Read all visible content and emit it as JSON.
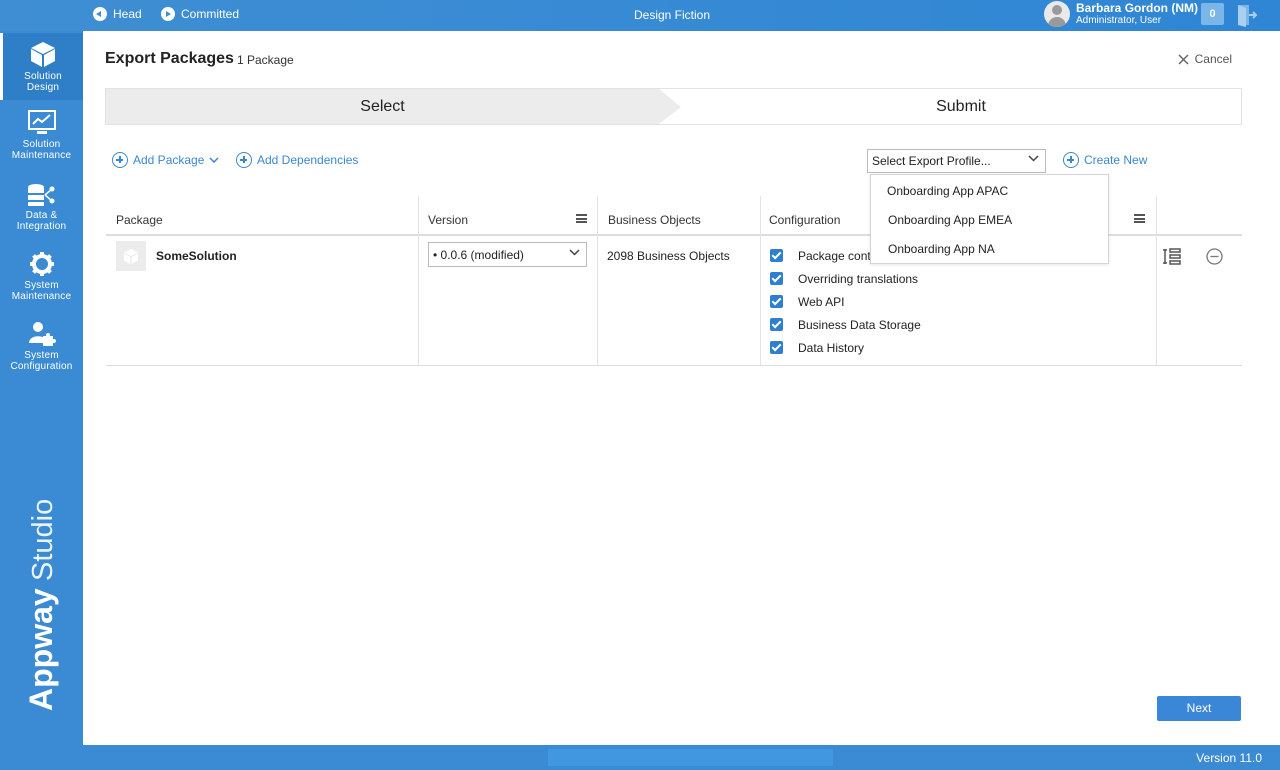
{
  "topbar": {
    "head_label": "Head",
    "committed_label": "Committed",
    "project_name": "Design Fiction",
    "user_name": "Barbara Gordon (NM)",
    "user_role": "Administrator, User",
    "notification_count": "0"
  },
  "sidebar": {
    "items": [
      {
        "label_line1": "Solution",
        "label_line2": "Design"
      },
      {
        "label_line1": "Solution",
        "label_line2": "Maintenance"
      },
      {
        "label_line1": "Data &",
        "label_line2": "Integration"
      },
      {
        "label_line1": "System",
        "label_line2": "Maintenance"
      },
      {
        "label_line1": "System",
        "label_line2": "Configuration"
      }
    ],
    "brand_bold": "Appway",
    "brand_light": "Studio"
  },
  "page": {
    "title": "Export Packages",
    "subtitle": "1 Package",
    "cancel_label": "Cancel",
    "steps": [
      "Select",
      "Submit"
    ]
  },
  "toolbar": {
    "add_package": "Add Package",
    "add_dependencies": "Add Dependencies",
    "export_profile_value": "Select Export Profile...",
    "create_new": "Create New",
    "profile_options": [
      "Onboarding App APAC",
      "Onboarding App EMEA",
      "Onboarding App NA"
    ]
  },
  "table": {
    "headers": [
      "Package",
      "Version",
      "Business Objects",
      "Configuration"
    ],
    "row": {
      "package": "SomeSolution",
      "version": "• 0.0.6 (modified)",
      "business_objects": "2098 Business Objects",
      "configuration": [
        "Package cont",
        "Overriding translations",
        "Web API",
        "Business Data Storage",
        "Data History"
      ]
    }
  },
  "actions": {
    "next_label": "Next"
  },
  "footer": {
    "version": "Version 11.0"
  },
  "colors": {
    "brand_blue": "#3a8bd3",
    "link_blue": "#3a87cf",
    "checkbox_blue": "#2f7fd0"
  }
}
